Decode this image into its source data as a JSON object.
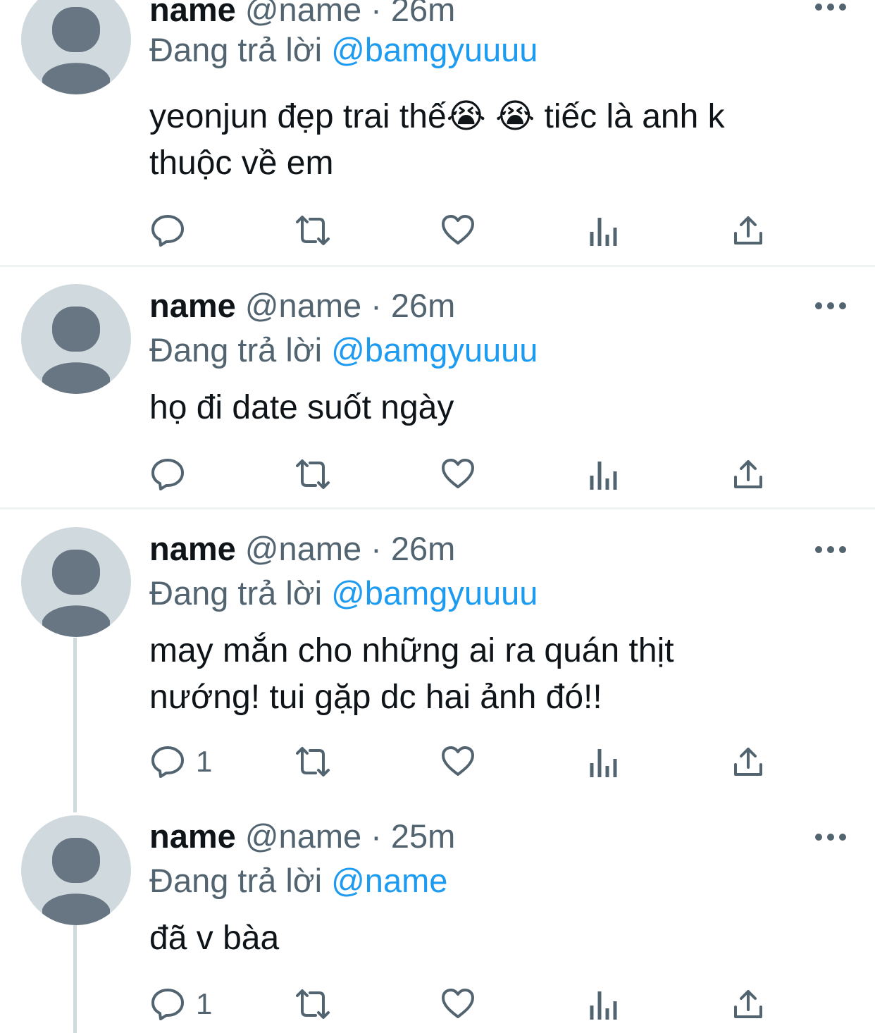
{
  "colors": {
    "name": "#0f1419",
    "meta": "#536471",
    "link": "#1d9bf0",
    "avatar_bg": "#cfd9de",
    "avatar_fg": "#687684",
    "divider": "#eff3f4"
  },
  "icons": [
    "reply-icon",
    "retweet-icon",
    "like-icon",
    "views-icon",
    "share-icon",
    "more-icon",
    "avatar-icon"
  ],
  "tweets": [
    {
      "name": "name",
      "meta": "@name · 26m",
      "reply_prefix": "Đang trả lời",
      "reply_handle": "@bamgyuuuu",
      "text_line1": "yeonjun đẹp trai thế😭 😭  tiếc là anh k",
      "text_line2": "thuộc về em",
      "reply_count": ""
    },
    {
      "name": "name",
      "meta": "@name · 26m",
      "reply_prefix": "Đang trả lời",
      "reply_handle": "@bamgyuuuu",
      "text_line1": "họ đi date suốt ngày",
      "reply_count": ""
    },
    {
      "name": "name",
      "meta": "@name · 26m",
      "reply_prefix": "Đang trả lời",
      "reply_handle": "@bamgyuuuu",
      "text_line1": "may mắn cho những ai ra quán thịt",
      "text_line2": "nướng! tui gặp dc hai ảnh đó!!",
      "reply_count": "1"
    },
    {
      "name": "name",
      "meta": "@name · 25m",
      "reply_prefix": "Đang trả lời",
      "reply_handle": "@name",
      "text_line1": "đã v bàa",
      "reply_count": "1"
    }
  ]
}
